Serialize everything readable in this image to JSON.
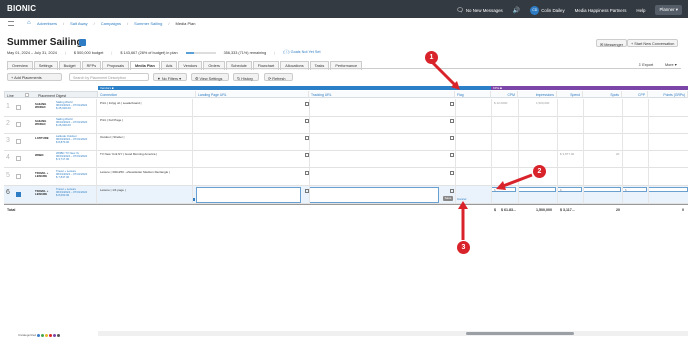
{
  "app": {
    "logo": "BIONIC"
  },
  "breadcrumb": [
    "Advertisers",
    "Salt Away",
    "Campaigns",
    "Summer Sailing",
    "Media Plan"
  ],
  "topbar": {
    "messages": "No New Messages",
    "user_initials": "CD",
    "user_name": "Colin Dailey",
    "org": "Media Happiness Partners",
    "help": "Help",
    "planner": "Planner ▾"
  },
  "campaign": {
    "title": "Summer Sailing",
    "dates": "May 01, 2024 – July 31, 2024",
    "budget": "$ 500,000 budget",
    "in_plan": "$ 143,667 (28% of budget) in plan",
    "in_plan_fraction": 0.28,
    "remaining": "356,333 (71%) remaining",
    "goals_link": "(ⓘ) Goals Not Yet Set"
  },
  "header_buttons": {
    "messenger": "✉ Messenger",
    "conversation": "+ Start New Conversation"
  },
  "tabs": [
    "Overview",
    "Settings",
    "Budget",
    "RFPs",
    "Proposals",
    "Media Plan",
    "Ads",
    "Vendors",
    "Orders",
    "Schedule",
    "Flowchart",
    "Allocations",
    "Tasks",
    "Performance"
  ],
  "active_tab": "Media Plan",
  "right_actions": {
    "export": "⇩ Export",
    "more": "More ▾"
  },
  "toolbar": {
    "add_placements": "+ Add Placements",
    "search_placeholder": "Search by Placement Description",
    "no_filters": "▼ No Filters ▾",
    "view_settings": "⚙ View Settings",
    "history": "↻ History",
    "refresh": "⟳ Refresh"
  },
  "grid": {
    "left_headers": {
      "line": "Line",
      "digest": "Placement Digest"
    },
    "band_blue": "Vendors ■",
    "band_purple": "KPIs ■",
    "columns": [
      "Connection",
      "Landing Page URL",
      "Tracking URL",
      "Flag",
      "CPM",
      "Impressions",
      "Spend",
      "Spots",
      "CPP",
      "Points (GRPs)"
    ],
    "rows": [
      {
        "line": "1",
        "logo": "SAILING WORLD",
        "title": "Sailing World",
        "dates": "06/01/2024 – 07/31/2024",
        "amount": "$ 25,000.00",
        "connection": "Print | 1/2pg ob | Leaderboard |",
        "cost": "$ 12.0000",
        "impressions": "1,500,000"
      },
      {
        "line": "2",
        "logo": "SAILING WORLD",
        "title": "Sailing World",
        "dates": "06/01/2024 – 07/31/2024",
        "amount": "$ 26,000.00",
        "connection": "Print | Full Page |"
      },
      {
        "line": "3",
        "logo": "LATITUDE",
        "title": "Latitude Outdoor",
        "dates": "06/01/2024 – 07/31/2024",
        "amount": "$ 8,870.00",
        "connection": "Outdoor | Shelter |"
      },
      {
        "line": "4",
        "logo": "WNBC",
        "title": "WNBC TV New Yo",
        "dates": "06/01/2024 – 07/31/2024",
        "amount": "$ 3,717.00",
        "connection": "TV New York NY | Good Morning America |",
        "spend": "$ 3,877.00",
        "spots": "20"
      },
      {
        "line": "5",
        "logo": "TRAVEL + LEISURE",
        "title": "Travel + Leisure",
        "dates": "06/01/2024 – 07/31/2024",
        "amount": "$ 7,847.00",
        "connection": "Leisure | 300x250 - eNewsletter Medium Rectangle |"
      },
      {
        "line": "6",
        "logo": "TRAVEL + LEISURE",
        "title": "Travel + Leisure",
        "dates": "06/01/2024 – 07/31/2024",
        "amount": "$ 8,000.00",
        "connection": "Leisure | 1/4 page |",
        "cost": "$",
        "spend": "$",
        "cpp": "$"
      }
    ],
    "save_button": "Save",
    "cancel_link": "Cancel",
    "totals": {
      "label": "Total",
      "cost": "$",
      "cpm": "$ 61.83...",
      "impressions": "1,500,000",
      "spend": "$ 3,117...",
      "spots": "20",
      "points": "0"
    }
  },
  "markers": [
    "1",
    "2",
    "3"
  ],
  "status_label": "Uncategorized"
}
